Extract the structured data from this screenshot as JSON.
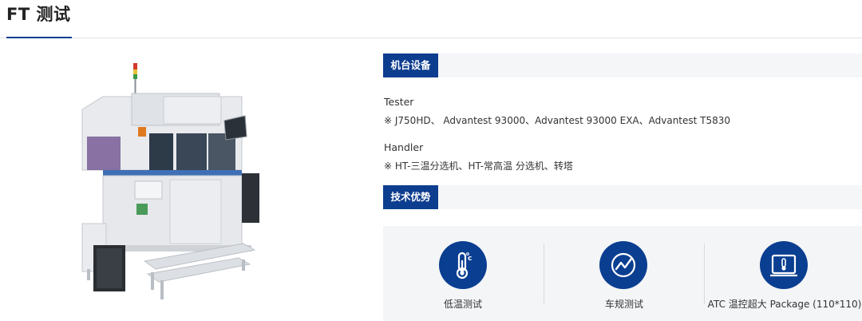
{
  "page": {
    "title": "FT 测试"
  },
  "equipment": {
    "section_label": "机台设备",
    "tester": {
      "label": "Tester",
      "detail": "※ J750HD、 Advantest 93000、Advantest 93000 EXA、Advantest T5830"
    },
    "handler": {
      "label": "Handler",
      "detail": "※ HT-三温分选机、HT-常高温 分选机、转塔"
    }
  },
  "advantages": {
    "section_label": "技术优势",
    "items": [
      {
        "label": "低温测试",
        "icon": "thermometer-celsius-icon"
      },
      {
        "label": "车规测试",
        "icon": "trend-line-icon"
      },
      {
        "label": "ATC 温控超大 Package (110*110)",
        "icon": "monitor-thermometer-icon"
      }
    ]
  },
  "colors": {
    "accent": "#0d3d8e",
    "panel_bg": "#f4f5f7"
  }
}
